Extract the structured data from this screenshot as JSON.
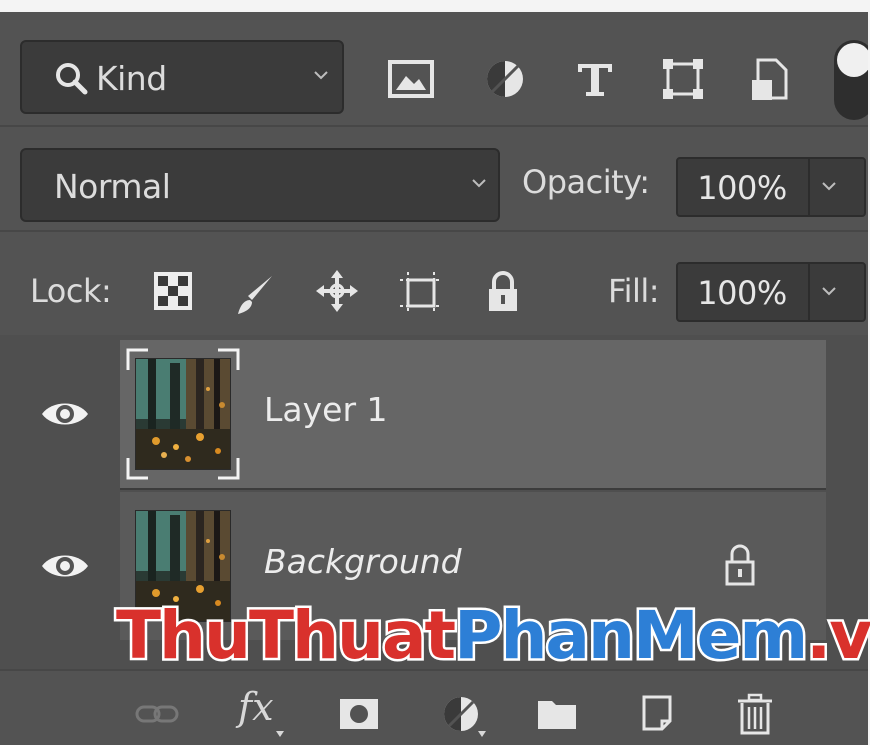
{
  "filter": {
    "kind_label": "Kind",
    "icons": [
      "pixel-layer-filter-icon",
      "adjustment-layer-filter-icon",
      "type-layer-filter-icon",
      "shape-layer-filter-icon",
      "smart-object-filter-icon"
    ]
  },
  "blend": {
    "mode": "Normal",
    "opacity_label": "Opacity:",
    "opacity_value": "100%"
  },
  "lock": {
    "label": "Lock:",
    "fill_label": "Fill:",
    "fill_value": "100%",
    "icons": [
      "lock-transparent-pixels-icon",
      "lock-image-pixels-icon",
      "lock-position-icon",
      "lock-artboard-icon",
      "lock-all-icon"
    ]
  },
  "layers": [
    {
      "name": "Layer 1",
      "visible": true,
      "selected": true,
      "locked": false
    },
    {
      "name": "Background",
      "visible": true,
      "selected": false,
      "locked": true
    }
  ],
  "bottom_bar": {
    "fx_label": "fx",
    "icons": [
      "link-layers-icon",
      "layer-style-icon",
      "layer-mask-icon",
      "adjustment-layer-icon",
      "group-folder-icon",
      "new-layer-icon",
      "trash-icon"
    ]
  },
  "watermark": {
    "part1": "ThuThuat",
    "part2": "PhanMem",
    "part3": ".vn"
  },
  "colors": {
    "panel": "#535353",
    "selected_layer": "#666666",
    "watermark_red": "#d9312c",
    "watermark_blue": "#2d7fd6"
  }
}
